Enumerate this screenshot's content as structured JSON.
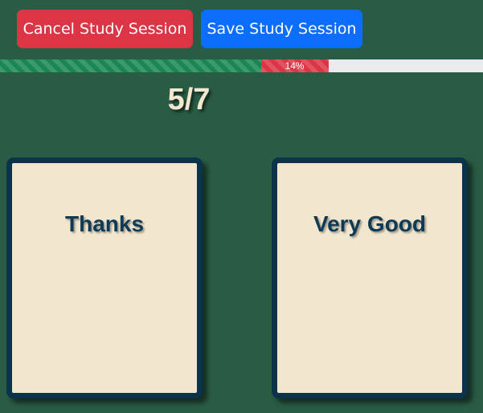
{
  "toolbar": {
    "cancel_label": "Cancel Study Session",
    "save_label": "Save Study Session"
  },
  "progress": {
    "correct_fraction": 0.54,
    "incorrect_fraction": 0.14,
    "incorrect_label": "14%"
  },
  "counter": {
    "text": "5/7"
  },
  "cards": [
    {
      "label": "Thanks"
    },
    {
      "label": "Very Good"
    }
  ],
  "colors": {
    "background": "#295c45",
    "cancel": "#dc3545",
    "save": "#0d6efd",
    "progress_correct": "#198754",
    "progress_incorrect": "#dc3545",
    "card_face": "#f2e6cf",
    "card_border": "#0b334a"
  }
}
